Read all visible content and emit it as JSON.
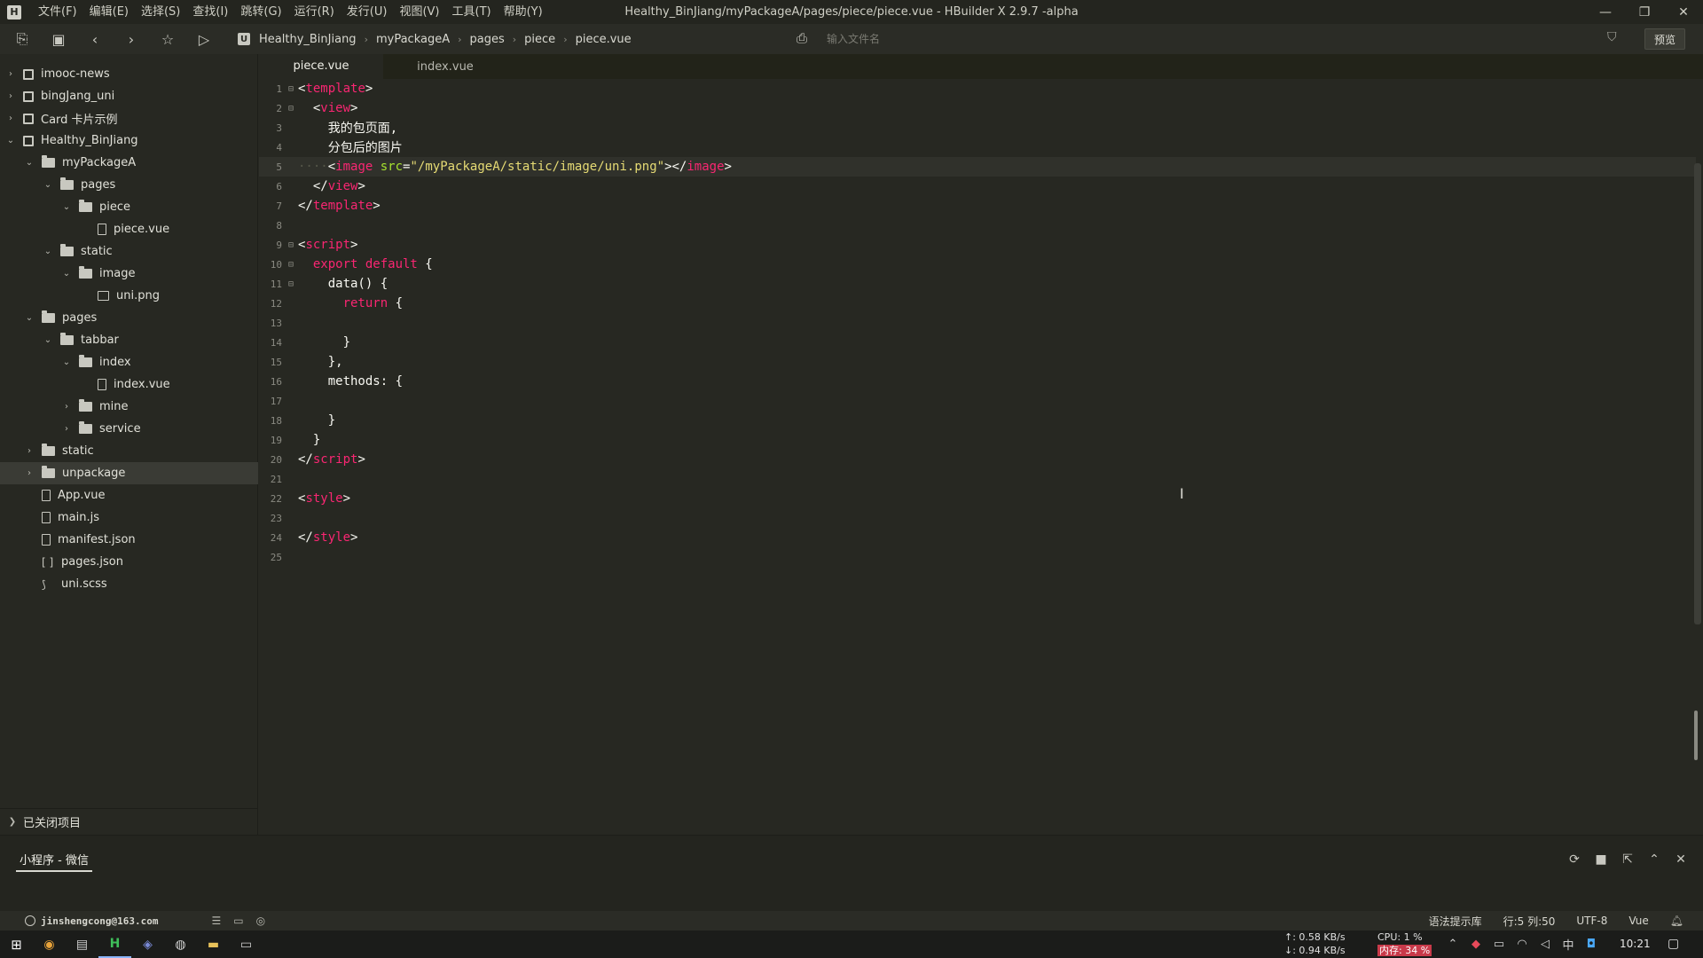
{
  "window": {
    "title": "Healthy_BinJiang/myPackageA/pages/piece/piece.vue - HBuilder X 2.9.7 -alpha",
    "logo": "H",
    "minimize": "—",
    "restore": "❐",
    "close": "✕"
  },
  "menu": [
    "文件(F)",
    "编辑(E)",
    "选择(S)",
    "查找(I)",
    "跳转(G)",
    "运行(R)",
    "发行(U)",
    "视图(V)",
    "工具(T)",
    "帮助(Y)"
  ],
  "toolbar": {
    "breadcrumb": [
      "Healthy_BinJiang",
      "myPackageA",
      "pages",
      "piece",
      "piece.vue"
    ],
    "search_placeholder": "输入文件名",
    "preview_label": "预览"
  },
  "sidebar": {
    "items": [
      {
        "label": "imooc-news",
        "icon": "project-icon",
        "depth": 0,
        "expanded": false
      },
      {
        "label": "bingJang_uni",
        "icon": "project-icon",
        "depth": 0,
        "expanded": false
      },
      {
        "label": "Card 卡片示例",
        "icon": "project-icon",
        "depth": 0,
        "expanded": false
      },
      {
        "label": "Healthy_BinJiang",
        "icon": "project-icon",
        "depth": 0,
        "expanded": true
      },
      {
        "label": "myPackageA",
        "icon": "folder-icon",
        "depth": 1,
        "expanded": true
      },
      {
        "label": "pages",
        "icon": "folder-icon",
        "depth": 2,
        "expanded": true
      },
      {
        "label": "piece",
        "icon": "folder-icon",
        "depth": 3,
        "expanded": true
      },
      {
        "label": "piece.vue",
        "icon": "file-icon",
        "depth": 4,
        "expanded": null
      },
      {
        "label": "static",
        "icon": "folder-icon",
        "depth": 2,
        "expanded": true
      },
      {
        "label": "image",
        "icon": "folder-icon",
        "depth": 3,
        "expanded": true
      },
      {
        "label": "uni.png",
        "icon": "image-icon",
        "depth": 4,
        "expanded": null
      },
      {
        "label": "pages",
        "icon": "folder-icon",
        "depth": 1,
        "expanded": true
      },
      {
        "label": "tabbar",
        "icon": "folder-icon",
        "depth": 2,
        "expanded": true
      },
      {
        "label": "index",
        "icon": "folder-icon",
        "depth": 3,
        "expanded": true
      },
      {
        "label": "index.vue",
        "icon": "file-icon",
        "depth": 4,
        "expanded": null
      },
      {
        "label": "mine",
        "icon": "folder-icon",
        "depth": 3,
        "expanded": false
      },
      {
        "label": "service",
        "icon": "folder-icon",
        "depth": 3,
        "expanded": false
      },
      {
        "label": "static",
        "icon": "folder-icon",
        "depth": 1,
        "expanded": false
      },
      {
        "label": "unpackage",
        "icon": "folder-icon",
        "depth": 1,
        "expanded": false,
        "selected": true
      },
      {
        "label": "App.vue",
        "icon": "file-icon",
        "depth": 1,
        "expanded": null
      },
      {
        "label": "main.js",
        "icon": "file-icon",
        "depth": 1,
        "expanded": null
      },
      {
        "label": "manifest.json",
        "icon": "file-icon",
        "depth": 1,
        "expanded": null
      },
      {
        "label": "pages.json",
        "icon": "bracket-icon",
        "depth": 1,
        "expanded": null
      },
      {
        "label": "uni.scss",
        "icon": "scss-icon",
        "depth": 1,
        "expanded": null
      }
    ],
    "closed_projects": "已关闭项目"
  },
  "tabs": [
    {
      "label": "piece.vue",
      "active": true
    },
    {
      "label": "index.vue",
      "active": false
    }
  ],
  "editor": {
    "current_line": 5,
    "lines": [
      {
        "n": "1",
        "fold": "⊟",
        "tokens": [
          [
            "t-punc",
            "<"
          ],
          [
            "t-tag",
            "template"
          ],
          [
            "t-punc",
            ">"
          ]
        ]
      },
      {
        "n": "2",
        "fold": "⊟",
        "tokens": [
          [
            "t-punc",
            "  <"
          ],
          [
            "t-tag",
            "view"
          ],
          [
            "t-punc",
            ">"
          ]
        ]
      },
      {
        "n": "3",
        "fold": "",
        "tokens": [
          [
            "t-punc",
            "    我的包页面,"
          ]
        ]
      },
      {
        "n": "4",
        "fold": "",
        "tokens": [
          [
            "t-punc",
            "    分包后的图片"
          ]
        ]
      },
      {
        "n": "5",
        "fold": "",
        "tokens": [
          [
            "indent-dots",
            "····"
          ],
          [
            "t-punc",
            "<"
          ],
          [
            "t-tag",
            "image"
          ],
          [
            "t-punc",
            " "
          ],
          [
            "t-attr",
            "src"
          ],
          [
            "t-punc",
            "="
          ],
          [
            "t-str",
            "\"/myPackageA/static/image/uni.png\""
          ],
          [
            "t-punc",
            "></"
          ],
          [
            "t-tag",
            "image"
          ],
          [
            "t-punc",
            ">"
          ]
        ]
      },
      {
        "n": "6",
        "fold": "",
        "tokens": [
          [
            "t-punc",
            "  </"
          ],
          [
            "t-tag",
            "view"
          ],
          [
            "t-punc",
            ">"
          ]
        ]
      },
      {
        "n": "7",
        "fold": "",
        "tokens": [
          [
            "t-punc",
            "</"
          ],
          [
            "t-tag",
            "template"
          ],
          [
            "t-punc",
            ">"
          ]
        ]
      },
      {
        "n": "8",
        "fold": "",
        "tokens": []
      },
      {
        "n": "9",
        "fold": "⊟",
        "tokens": [
          [
            "t-punc",
            "<"
          ],
          [
            "t-tag",
            "script"
          ],
          [
            "t-punc",
            ">"
          ]
        ]
      },
      {
        "n": "10",
        "fold": "⊟",
        "tokens": [
          [
            "t-kw",
            "  export default"
          ],
          [
            "t-punc",
            " {"
          ]
        ]
      },
      {
        "n": "11",
        "fold": "⊟",
        "tokens": [
          [
            "t-fn",
            "    data() {"
          ]
        ]
      },
      {
        "n": "12",
        "fold": "",
        "tokens": [
          [
            "t-kw",
            "      return"
          ],
          [
            "t-punc",
            " {"
          ]
        ]
      },
      {
        "n": "13",
        "fold": "",
        "tokens": []
      },
      {
        "n": "14",
        "fold": "",
        "tokens": [
          [
            "t-punc",
            "      }"
          ]
        ]
      },
      {
        "n": "15",
        "fold": "",
        "tokens": [
          [
            "t-punc",
            "    },"
          ]
        ]
      },
      {
        "n": "16",
        "fold": "",
        "tokens": [
          [
            "t-fn",
            "    methods: {"
          ]
        ]
      },
      {
        "n": "17",
        "fold": "",
        "tokens": []
      },
      {
        "n": "18",
        "fold": "",
        "tokens": [
          [
            "t-punc",
            "    }"
          ]
        ]
      },
      {
        "n": "19",
        "fold": "",
        "tokens": [
          [
            "t-punc",
            "  }"
          ]
        ]
      },
      {
        "n": "20",
        "fold": "",
        "tokens": [
          [
            "t-punc",
            "</"
          ],
          [
            "t-tag",
            "script"
          ],
          [
            "t-punc",
            ">"
          ]
        ]
      },
      {
        "n": "21",
        "fold": "",
        "tokens": []
      },
      {
        "n": "22",
        "fold": "",
        "tokens": [
          [
            "t-punc",
            "<"
          ],
          [
            "t-tag",
            "style"
          ],
          [
            "t-punc",
            ">"
          ]
        ]
      },
      {
        "n": "23",
        "fold": "",
        "tokens": []
      },
      {
        "n": "24",
        "fold": "",
        "tokens": [
          [
            "t-punc",
            "</"
          ],
          [
            "t-tag",
            "style"
          ],
          [
            "t-punc",
            ">"
          ]
        ]
      },
      {
        "n": "25",
        "fold": "",
        "tokens": []
      }
    ]
  },
  "console": {
    "tab_label": "小程序 - 微信"
  },
  "status": {
    "account": "jinshengcong@163.com",
    "syntax_lib": "语法提示库",
    "position": "行:5  列:50",
    "encoding": "UTF-8",
    "language": "Vue"
  },
  "taskbar": {
    "net_up": "↑: 0.58 KB/s",
    "net_down": "↓: 0.94 KB/s",
    "cpu": "CPU: 1 %",
    "mem": "内存: 34 %",
    "ime": "中",
    "time": "10:21"
  },
  "colors": {
    "background": "#272822",
    "tag": "#f92672",
    "attr": "#a6e22e",
    "string": "#e6db74"
  }
}
